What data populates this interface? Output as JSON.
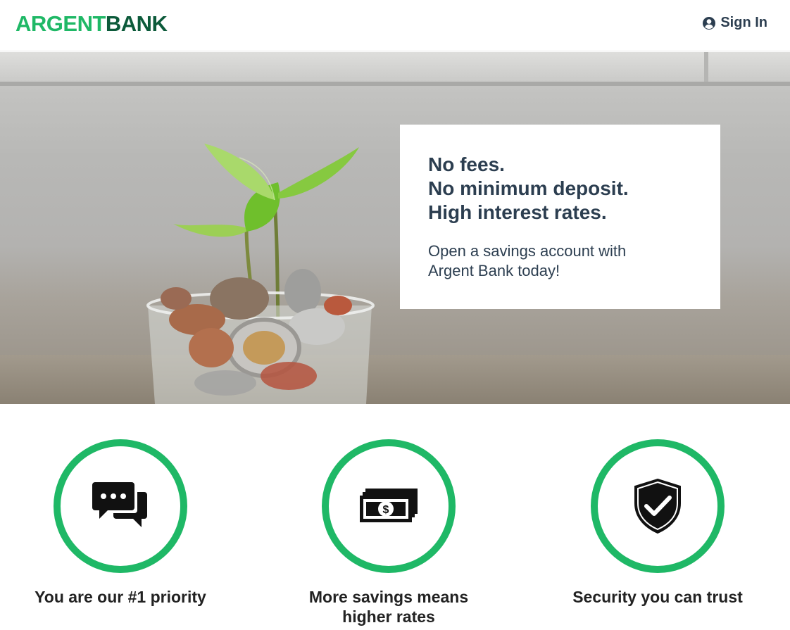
{
  "header": {
    "logo_part_1": "ARGENT",
    "logo_part_2": "BANK",
    "sign_in_label": "Sign In",
    "sign_in_icon": "user-circle-icon"
  },
  "hero": {
    "image": "plant-growing-from-coins-in-glass-jar",
    "headline_lines": [
      "No fees.",
      "No minimum deposit.",
      "High interest rates."
    ],
    "subtext": "Open a savings account with Argent Bank today!"
  },
  "features": [
    {
      "icon": "chat-bubbles-icon",
      "title": "You are our #1 priority"
    },
    {
      "icon": "money-bill-icon",
      "title": "More savings means higher rates"
    },
    {
      "icon": "shield-check-icon",
      "title": "Security you can trust"
    }
  ],
  "colors": {
    "brand_green": "#1fb866",
    "brand_dark_green": "#0c5a3a",
    "text_dark": "#2c3e50",
    "feature_text": "#222222"
  }
}
